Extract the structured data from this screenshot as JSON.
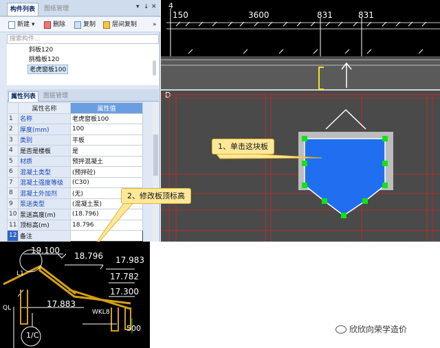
{
  "left_panel": {
    "tabs": [
      "构件列表",
      "图纸管理"
    ],
    "tab_controls": [
      "▾",
      "↓",
      "✕"
    ],
    "toolbar": {
      "new_label": "新建",
      "new_arrow": "▾",
      "delete_label": "删除",
      "copy_label": "复制",
      "floor_copy_label": "层间复制",
      "more": "»"
    },
    "search_placeholder": "搜索构件...",
    "tree_items": [
      "斜板120",
      "挑檐板120",
      "老虎窗板100"
    ],
    "property_tabs": [
      "属性列表",
      "图层管理"
    ],
    "property_headers": {
      "name": "属性名称",
      "value": "属性值"
    },
    "properties": [
      {
        "no": "1",
        "name": "名称",
        "value": "老虎窗板100",
        "linked": true
      },
      {
        "no": "2",
        "name": "厚度(mm)",
        "value": "100",
        "linked": true
      },
      {
        "no": "3",
        "name": "类别",
        "value": "平板",
        "linked": true
      },
      {
        "no": "4",
        "name": "是否是楼板",
        "value": "是",
        "linked": false
      },
      {
        "no": "5",
        "name": "材质",
        "value": "预拌混凝土",
        "linked": true
      },
      {
        "no": "6",
        "name": "混凝土类型",
        "value": "(预拌砼)",
        "linked": true
      },
      {
        "no": "7",
        "name": "混凝土强度等级",
        "value": "(C30)",
        "linked": true
      },
      {
        "no": "8",
        "name": "混凝土外加剂",
        "value": "(无)",
        "linked": true
      },
      {
        "no": "9",
        "name": "泵送类型",
        "value": "(混凝土泵)",
        "linked": true
      },
      {
        "no": "10",
        "name": "泵送高度(m)",
        "value": "(18.796)",
        "linked": false
      },
      {
        "no": "11",
        "name": "顶标高(m)",
        "value": "18.796",
        "linked": false
      },
      {
        "no": "12",
        "name": "备注",
        "value": "",
        "linked": false
      }
    ]
  },
  "cad": {
    "dimensions": [
      "150",
      "3600",
      "831",
      "831"
    ],
    "axis_top": "4",
    "axis_side": "D"
  },
  "callouts": {
    "click_board": "1、单击这块板",
    "modify_top": "2、修改板顶标高"
  },
  "inset": {
    "labels": [
      "19.100",
      "18.796",
      "17.983",
      "17.782",
      "17.300",
      "17.883",
      "L1",
      "QL",
      "WKL8",
      "500",
      "1/C"
    ]
  },
  "watermark": "欣欣向荣学造价",
  "colors": {
    "board_fill": "#1f6ff0",
    "grip": "#12e312",
    "callout_bg": "#fde89a",
    "grid_red": "#b03030",
    "cad_bg": "#4a4a4a",
    "cad_top": "#000000",
    "selected_row": "#2f63c4",
    "yellow_line": "#f2e32c"
  }
}
